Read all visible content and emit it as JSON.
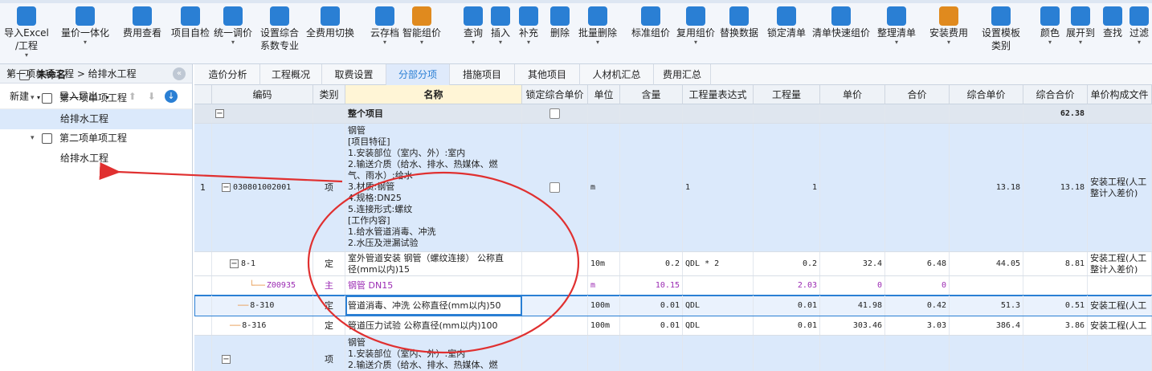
{
  "toolbar": [
    {
      "label": "导入Excel\n/工程",
      "icon": "import-excel-icon",
      "color": "#2a7fd4",
      "dd": true
    },
    {
      "label": "量价一体化",
      "icon": "integration-icon",
      "color": "#2a7fd4",
      "dd": true
    },
    {
      "label": "费用查看",
      "icon": "fee-view-icon",
      "color": "#2a7fd4",
      "dd": false
    },
    {
      "label": "项目自检",
      "icon": "self-check-icon",
      "color": "#2a7fd4",
      "dd": false
    },
    {
      "label": "统一调价",
      "icon": "price-adjust-icon",
      "color": "#2a7fd4",
      "dd": true
    },
    {
      "label": "设置综合\n系数专业",
      "icon": "coefficient-icon",
      "color": "#2a7fd4",
      "dd": false
    },
    {
      "label": "全费用切换",
      "icon": "full-fee-switch-icon",
      "color": "#2a7fd4",
      "dd": false
    },
    {
      "label": "云存档",
      "icon": "cloud-archive-icon",
      "color": "#2a7fd4",
      "dd": true
    },
    {
      "label": "智能组价",
      "icon": "smart-price-icon",
      "color": "#e08a1e",
      "dd": true
    },
    {
      "label": "查询",
      "icon": "query-icon",
      "color": "#2a7fd4",
      "dd": true
    },
    {
      "label": "插入",
      "icon": "insert-icon",
      "color": "#2a7fd4",
      "dd": true
    },
    {
      "label": "补充",
      "icon": "supplement-icon",
      "color": "#2a7fd4",
      "dd": true
    },
    {
      "label": "删除",
      "icon": "delete-icon",
      "color": "#2a7fd4",
      "dd": false
    },
    {
      "label": "批量删除",
      "icon": "batch-delete-icon",
      "color": "#2a7fd4",
      "dd": true
    },
    {
      "label": "标准组价",
      "icon": "standard-price-icon",
      "color": "#2a7fd4",
      "dd": false
    },
    {
      "label": "复用组价",
      "icon": "reuse-price-icon",
      "color": "#2a7fd4",
      "dd": true
    },
    {
      "label": "替换数据",
      "icon": "replace-data-icon",
      "color": "#2a7fd4",
      "dd": false
    },
    {
      "label": "锁定清单",
      "icon": "lock-list-icon",
      "color": "#2a7fd4",
      "dd": false
    },
    {
      "label": "清单快速组价",
      "icon": "quick-price-icon",
      "color": "#2a7fd4",
      "dd": false
    },
    {
      "label": "整理清单",
      "icon": "organize-list-icon",
      "color": "#2a7fd4",
      "dd": true
    },
    {
      "label": "安装费用",
      "icon": "install-fee-icon",
      "color": "#e08a1e",
      "dd": true
    },
    {
      "label": "设置模板\n类别",
      "icon": "template-icon",
      "color": "#2a7fd4",
      "dd": false
    },
    {
      "label": "颜色",
      "icon": "color-icon",
      "color": "#2a7fd4",
      "dd": true
    },
    {
      "label": "展开到",
      "icon": "expand-to-icon",
      "color": "#2a7fd4",
      "dd": true
    },
    {
      "label": "查找",
      "icon": "find-icon",
      "color": "#2a7fd4",
      "dd": false
    },
    {
      "label": "过滤",
      "icon": "filter-icon",
      "color": "#2a7fd4",
      "dd": true
    }
  ],
  "sidebar": {
    "breadcrumb": "第一项单项工程 > 给排水工程",
    "new_label": "新建",
    "import_export_label": "导入导出",
    "up_arrow": "⬆",
    "down_arrow": "⬇",
    "collapse_glyph": "«",
    "download_glyph": "↓",
    "tree": [
      {
        "label": "未命名",
        "level": 0,
        "bold": true
      },
      {
        "label": "第一项单项工程",
        "level": 1
      },
      {
        "label": "给排水工程",
        "level": 2,
        "selected": true
      },
      {
        "label": "第二项单项工程",
        "level": 1
      },
      {
        "label": "给排水工程",
        "level": 2
      }
    ]
  },
  "tabs": [
    "造价分析",
    "工程概况",
    "取费设置",
    "分部分项",
    "措施项目",
    "其他项目",
    "人材机汇总",
    "费用汇总"
  ],
  "active_tab": 3,
  "columns": [
    "",
    "编码",
    "类别",
    "名称",
    "锁定综合单价",
    "单位",
    "含量",
    "工程量表达式",
    "工程量",
    "单价",
    "合价",
    "综合单价",
    "综合合价",
    "单价构成文件"
  ],
  "rows": [
    {
      "kind": "group",
      "code": "",
      "type": "",
      "name": "整个项目",
      "lock": true,
      "unit": "",
      "qty_ratio": "",
      "expr": "",
      "qty": "",
      "price": "",
      "sum": "",
      "unit_price": "",
      "total": "62.38",
      "file": ""
    },
    {
      "kind": "list",
      "idx": "1",
      "code": "030801002001",
      "type": "项",
      "name": "钢管\n[项目特征]\n1.安装部位（室内、外）:室内\n2.输送介质（给水、排水、热媒体、燃\n气、雨水）:给水\n3.材质:钢管\n4.规格:DN25\n5.连接形式:螺纹\n[工作内容]\n1.给水管道消毒、冲洗\n2.水压及泄漏试验",
      "lock": true,
      "unit": "m",
      "qty_ratio": "",
      "expr": "1",
      "qty": "1",
      "price": "",
      "sum": "",
      "unit_price": "13.18",
      "total": "13.18",
      "file": "安装工程(人工\n整计入差价)"
    },
    {
      "kind": "quota",
      "code": "8-1",
      "type": "定",
      "name": "室外管道安装 钢管（螺纹连接） 公称直\n径(mm以内)15",
      "lock": false,
      "unit": "10m",
      "qty_ratio": "0.2",
      "expr": "QDL * 2",
      "qty": "0.2",
      "price": "32.4",
      "sum": "6.48",
      "unit_price": "44.05",
      "total": "8.81",
      "file": "安装工程(人工\n整计入差价)"
    },
    {
      "kind": "main",
      "code": "Z00935",
      "type": "主",
      "name": "钢管 DN15",
      "lock": false,
      "unit": "m",
      "qty_ratio": "10.15",
      "expr": "",
      "qty": "2.03",
      "price": "0",
      "sum": "0",
      "unit_price": "",
      "total": "",
      "file": ""
    },
    {
      "kind": "quota-sel",
      "code": "8-310",
      "type": "定",
      "name": "管道消毒、冲洗 公称直径(mm以内)50",
      "lock": false,
      "unit": "100m",
      "qty_ratio": "0.01",
      "expr": "QDL",
      "qty": "0.01",
      "price": "41.98",
      "sum": "0.42",
      "unit_price": "51.3",
      "total": "0.51",
      "file": "安装工程(人工"
    },
    {
      "kind": "quota",
      "code": "8-316",
      "type": "定",
      "name": "管道压力试验 公称直径(mm以内)100",
      "lock": false,
      "unit": "100m",
      "qty_ratio": "0.01",
      "expr": "QDL",
      "qty": "0.01",
      "price": "303.46",
      "sum": "3.03",
      "unit_price": "386.4",
      "total": "3.86",
      "file": "安装工程(人工"
    },
    {
      "kind": "list",
      "idx": "",
      "code": "",
      "type": "项",
      "name": "钢管\n1.安装部位（室内、外）:室内\n2.输送介质（给水、排水、热媒体、燃",
      "lock": false,
      "unit": "",
      "qty_ratio": "",
      "expr": "",
      "qty": "",
      "price": "",
      "sum": "",
      "unit_price": "",
      "total": "",
      "file": ""
    }
  ],
  "colors": {
    "accent": "#2a7fd4",
    "annotation": "#e03030",
    "main_material": "#9b2bb3"
  }
}
